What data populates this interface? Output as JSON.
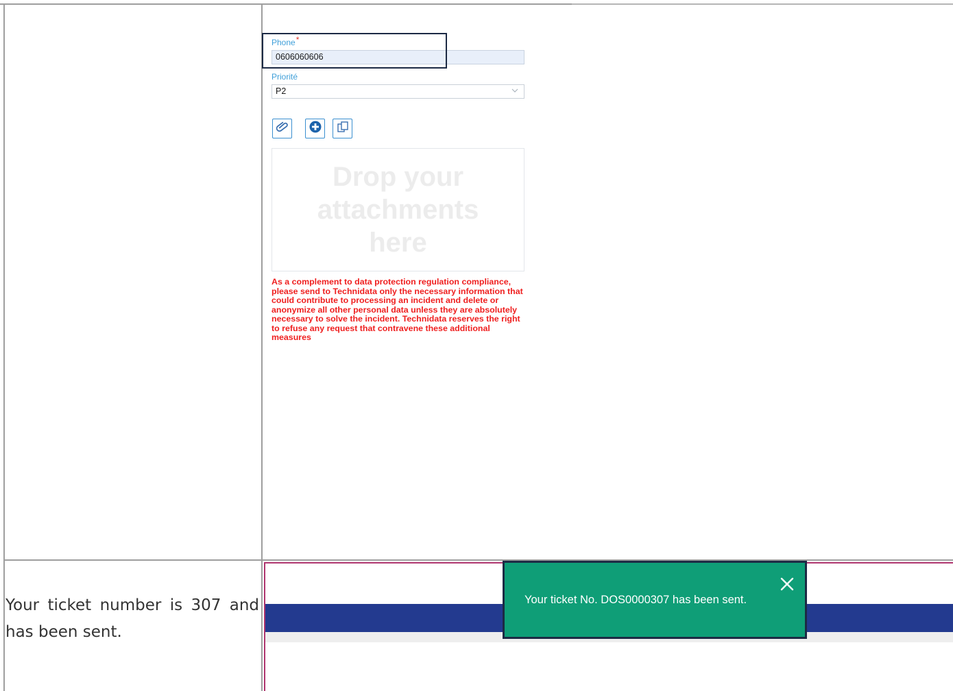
{
  "form": {
    "phone_label": "Phone",
    "required_mark": "*",
    "phone_value": "0606060606",
    "priority_label": "Priorité",
    "priority_value": "P2",
    "dropzone_text": "Drop your attachments here",
    "notice": "As a complement to data protection regulation compliance, please send to Technidata only the necessary information that could contribute to processing an incident and delete or anonymize all other personal data unless they are absolutely necessary to solve the incident. Technidata reserves the right to refuse any request that contravene these additional measures"
  },
  "icons": {
    "attach": "paperclip-icon",
    "add": "plus-circle-icon",
    "copy": "copy-icon",
    "close": "close-icon",
    "dropdown": "chevron-down-icon"
  },
  "caption": {
    "text": "Your ticket number is 307 and has been sent."
  },
  "toast": {
    "message": "Your ticket No. DOS0000307 has been sent."
  },
  "colors": {
    "label_blue": "#3f9fd9",
    "notice_red": "#ef1f1f",
    "toast_green": "#0f9e77",
    "band_blue": "#233a8f",
    "focus_border": "#1c2a44"
  }
}
